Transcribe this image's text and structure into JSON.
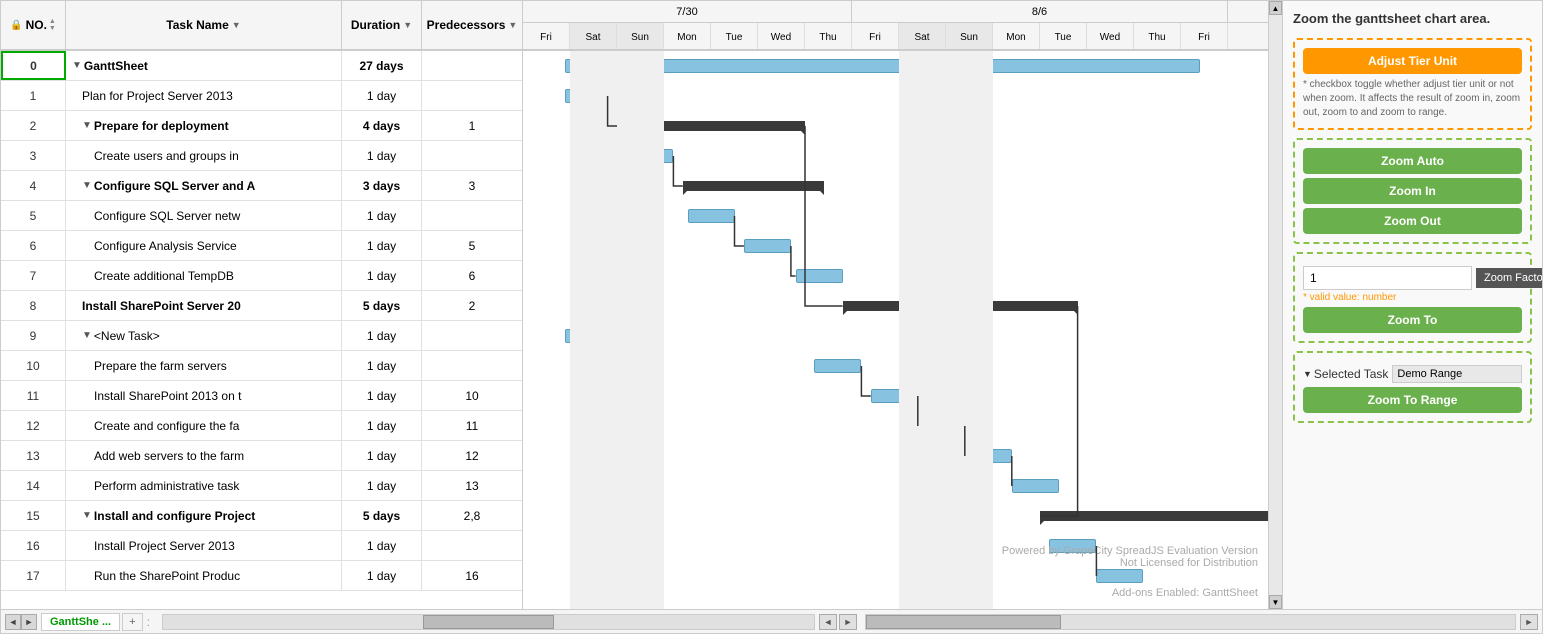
{
  "panel": {
    "title": "Zoom the ganttsheet chart area.",
    "adjust_tier_label": "Adjust Tier Unit",
    "adjust_tier_hint": "* checkbox toggle whether adjust tier unit or not when zoom. It affects the result of zoom in, zoom out, zoom to and zoom to range.",
    "zoom_auto_label": "Zoom Auto",
    "zoom_in_label": "Zoom In",
    "zoom_out_label": "Zoom Out",
    "zoom_factor_value": "1",
    "zoom_factor_label": "Zoom Factor",
    "zoom_factor_hint": "* valid value: number",
    "zoom_to_label": "Zoom To",
    "selected_task_label": "Selected Task",
    "demo_range_label": "Demo Range",
    "zoom_to_range_label": "Zoom To Range"
  },
  "grid": {
    "col_no": "NO.",
    "col_taskname": "Task Name",
    "col_duration": "Duration",
    "col_predecessors": "Predecessors",
    "rows": [
      {
        "no": "0",
        "name": "GanttSheet",
        "duration": "27 days",
        "predecessors": "",
        "indent": 0,
        "bold": true,
        "expand": true
      },
      {
        "no": "1",
        "name": "Plan for Project Server 2013",
        "duration": "1 day",
        "predecessors": "",
        "indent": 1,
        "bold": false,
        "expand": false
      },
      {
        "no": "2",
        "name": "Prepare for deployment",
        "duration": "4 days",
        "predecessors": "1",
        "indent": 1,
        "bold": true,
        "expand": true
      },
      {
        "no": "3",
        "name": "Create users and groups in",
        "duration": "1 day",
        "predecessors": "",
        "indent": 2,
        "bold": false,
        "expand": false
      },
      {
        "no": "4",
        "name": "Configure SQL Server and A",
        "duration": "3 days",
        "predecessors": "3",
        "indent": 1,
        "bold": true,
        "expand": true
      },
      {
        "no": "5",
        "name": "Configure SQL Server netw",
        "duration": "1 day",
        "predecessors": "",
        "indent": 2,
        "bold": false,
        "expand": false
      },
      {
        "no": "6",
        "name": "Configure Analysis Service",
        "duration": "1 day",
        "predecessors": "5",
        "indent": 2,
        "bold": false,
        "expand": false
      },
      {
        "no": "7",
        "name": "Create additional TempDB",
        "duration": "1 day",
        "predecessors": "6",
        "indent": 2,
        "bold": false,
        "expand": false
      },
      {
        "no": "8",
        "name": "Install SharePoint Server 20",
        "duration": "5 days",
        "predecessors": "2",
        "indent": 1,
        "bold": true,
        "expand": false
      },
      {
        "no": "9",
        "name": "<New Task>",
        "duration": "1 day",
        "predecessors": "",
        "indent": 1,
        "bold": false,
        "expand": true
      },
      {
        "no": "10",
        "name": "Prepare the farm servers",
        "duration": "1 day",
        "predecessors": "",
        "indent": 2,
        "bold": false,
        "expand": false
      },
      {
        "no": "11",
        "name": "Install SharePoint 2013 on t",
        "duration": "1 day",
        "predecessors": "10",
        "indent": 2,
        "bold": false,
        "expand": false
      },
      {
        "no": "12",
        "name": "Create and configure the fa",
        "duration": "1 day",
        "predecessors": "11",
        "indent": 2,
        "bold": false,
        "expand": false
      },
      {
        "no": "13",
        "name": "Add web servers to the farm",
        "duration": "1 day",
        "predecessors": "12",
        "indent": 2,
        "bold": false,
        "expand": false
      },
      {
        "no": "14",
        "name": "Perform administrative task",
        "duration": "1 day",
        "predecessors": "13",
        "indent": 2,
        "bold": false,
        "expand": false
      },
      {
        "no": "15",
        "name": "Install and configure Project",
        "duration": "5 days",
        "predecessors": "2,8",
        "indent": 1,
        "bold": true,
        "expand": true
      },
      {
        "no": "16",
        "name": "Install Project Server 2013",
        "duration": "1 day",
        "predecessors": "",
        "indent": 2,
        "bold": false,
        "expand": false
      },
      {
        "no": "17",
        "name": "Run the SharePoint Produc",
        "duration": "1 day",
        "predecessors": "16",
        "indent": 2,
        "bold": false,
        "expand": false
      }
    ]
  },
  "gantt": {
    "week1_date": "7/30",
    "week2_date": "8/6",
    "days": [
      "Fri",
      "Sat",
      "Sun",
      "Mon",
      "Tue",
      "Wed",
      "Thu",
      "Fri",
      "Sat",
      "Sun",
      "Mon",
      "Tue",
      "Wed",
      "Thu",
      "Fri"
    ],
    "watermark": "Powered by GrapeCity SpreadJS Evaluation Version\nNot Licensed for Distribution",
    "addon": "Add-ons Enabled: GanttSheet"
  },
  "tabs": {
    "sheet_tab": "GanttShe ...",
    "add_tab": "+"
  },
  "bottom": {
    "nav_left": "◄",
    "nav_right": "►"
  }
}
